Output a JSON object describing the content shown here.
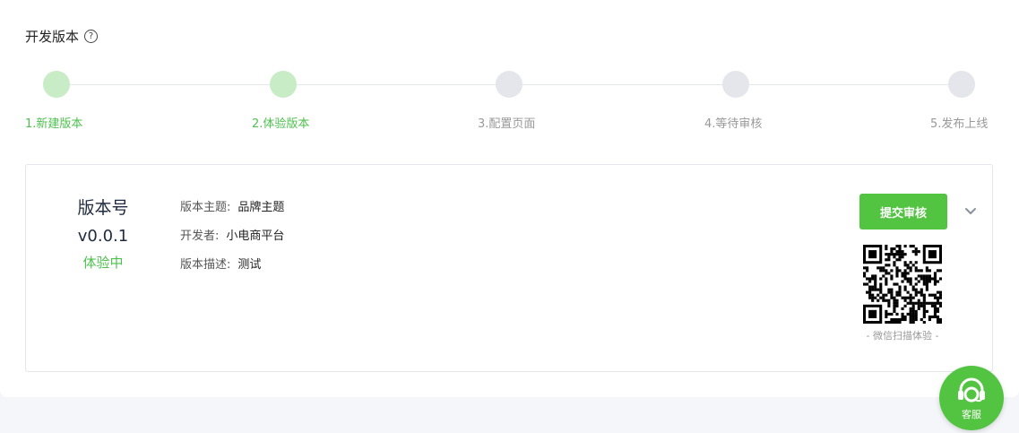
{
  "header": {
    "title": "开发版本",
    "help_icon": "question-circle-icon",
    "help_glyph": "?"
  },
  "steps": [
    {
      "label": "1.新建版本",
      "done": true
    },
    {
      "label": "2.体验版本",
      "done": true
    },
    {
      "label": "3.配置页面",
      "done": false
    },
    {
      "label": "4.等待审核",
      "done": false
    },
    {
      "label": "5.发布上线",
      "done": false
    }
  ],
  "version_card": {
    "label": "版本号",
    "version": "v0.0.1",
    "status": "体验中",
    "theme_label": "版本主题:",
    "theme_value": "品牌主题",
    "developer_label": "开发者:",
    "developer_value": "小电商平台",
    "desc_label": "版本描述:",
    "desc_value": "测试",
    "submit_label": "提交审核",
    "expand_icon": "chevron-down-icon",
    "qr_caption": "- 微信扫描体验 -"
  },
  "customer_service": {
    "label": "客服",
    "icon": "headset-icon"
  },
  "colors": {
    "accent": "#52c441",
    "step_done": "#c7ecc6",
    "step_todo": "#e4e6eb",
    "text_done": "#4ec14f"
  }
}
